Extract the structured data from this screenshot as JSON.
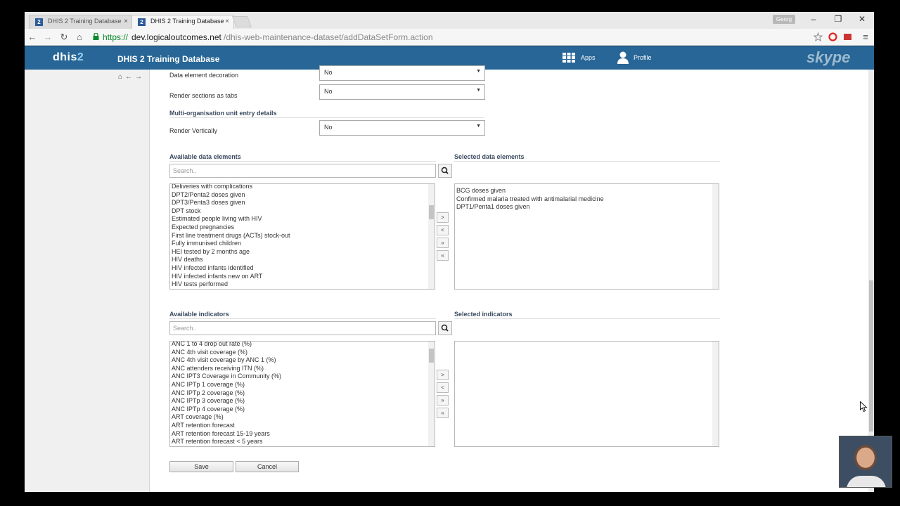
{
  "browser": {
    "tabs": [
      {
        "label": "DHIS 2 Training Database",
        "favicon": "2"
      },
      {
        "label": "DHIS 2 Training Database",
        "favicon": "2"
      }
    ],
    "user_chip": "Georg",
    "url_protocol": "https://",
    "url_host": "dev.logicaloutcomes.net",
    "url_path": "/dhis-web-maintenance-dataset/addDataSetForm.action"
  },
  "header": {
    "logo_main": "dhis",
    "logo_num": "2",
    "title": "DHIS 2 Training Database",
    "apps_label": "Apps",
    "profile_label": "Profile",
    "overlay_watermark": "skype"
  },
  "form": {
    "rows": [
      {
        "label": "Data element decoration",
        "value": "No"
      },
      {
        "label": "Render sections as tabs",
        "value": "No"
      },
      {
        "label": "Render Vertically",
        "value": "No"
      }
    ],
    "multi_org_heading": "Multi-organisation unit entry details",
    "data_elements": {
      "available_heading": "Available data elements",
      "selected_heading": "Selected data elements",
      "search_placeholder": "Search..",
      "available": [
        "Deliveries with complications",
        "DPT2/Penta2 doses given",
        "DPT3/Penta3 doses given",
        "DPT stock",
        "Estimated people living with HIV",
        "Expected pregnancies",
        "First line treatment drugs (ACTs) stock-out",
        "Fully immunised children",
        "HEI tested by 2 months age",
        "HIV deaths",
        "HIV infected infants identified",
        "HIV infected infants new on ART",
        "HIV tests performed"
      ],
      "selected": [
        "BCG doses given",
        "Confirmed malaria treated with antimalarial medicine",
        "DPT1/Penta1 doses given"
      ]
    },
    "indicators": {
      "available_heading": "Available indicators",
      "selected_heading": "Selected indicators",
      "search_placeholder": "Search..",
      "available": [
        "ANC 1 to 4 drop out rate (%)",
        "ANC 4th visit coverage (%)",
        "ANC 4th visit coverage by ANC 1 (%)",
        "ANC attenders receiving ITN (%)",
        "ANC IPT3 Coverage in Community (%)",
        "ANC IPTp 1 coverage (%)",
        "ANC IPTp 2 coverage (%)",
        "ANC IPTp 3 coverage (%)",
        "ANC IPTp 4 coverage (%)",
        "ART coverage (%)",
        "ART retention forecast",
        "ART retention forecast 15-19 years",
        "ART retention forecast < 5 years"
      ],
      "selected": []
    },
    "move_buttons": [
      ">",
      "<",
      "»",
      "«"
    ],
    "save_label": "Save",
    "cancel_label": "Cancel"
  },
  "colors": {
    "header_blue": "#276696",
    "heading_text": "#39495e"
  }
}
